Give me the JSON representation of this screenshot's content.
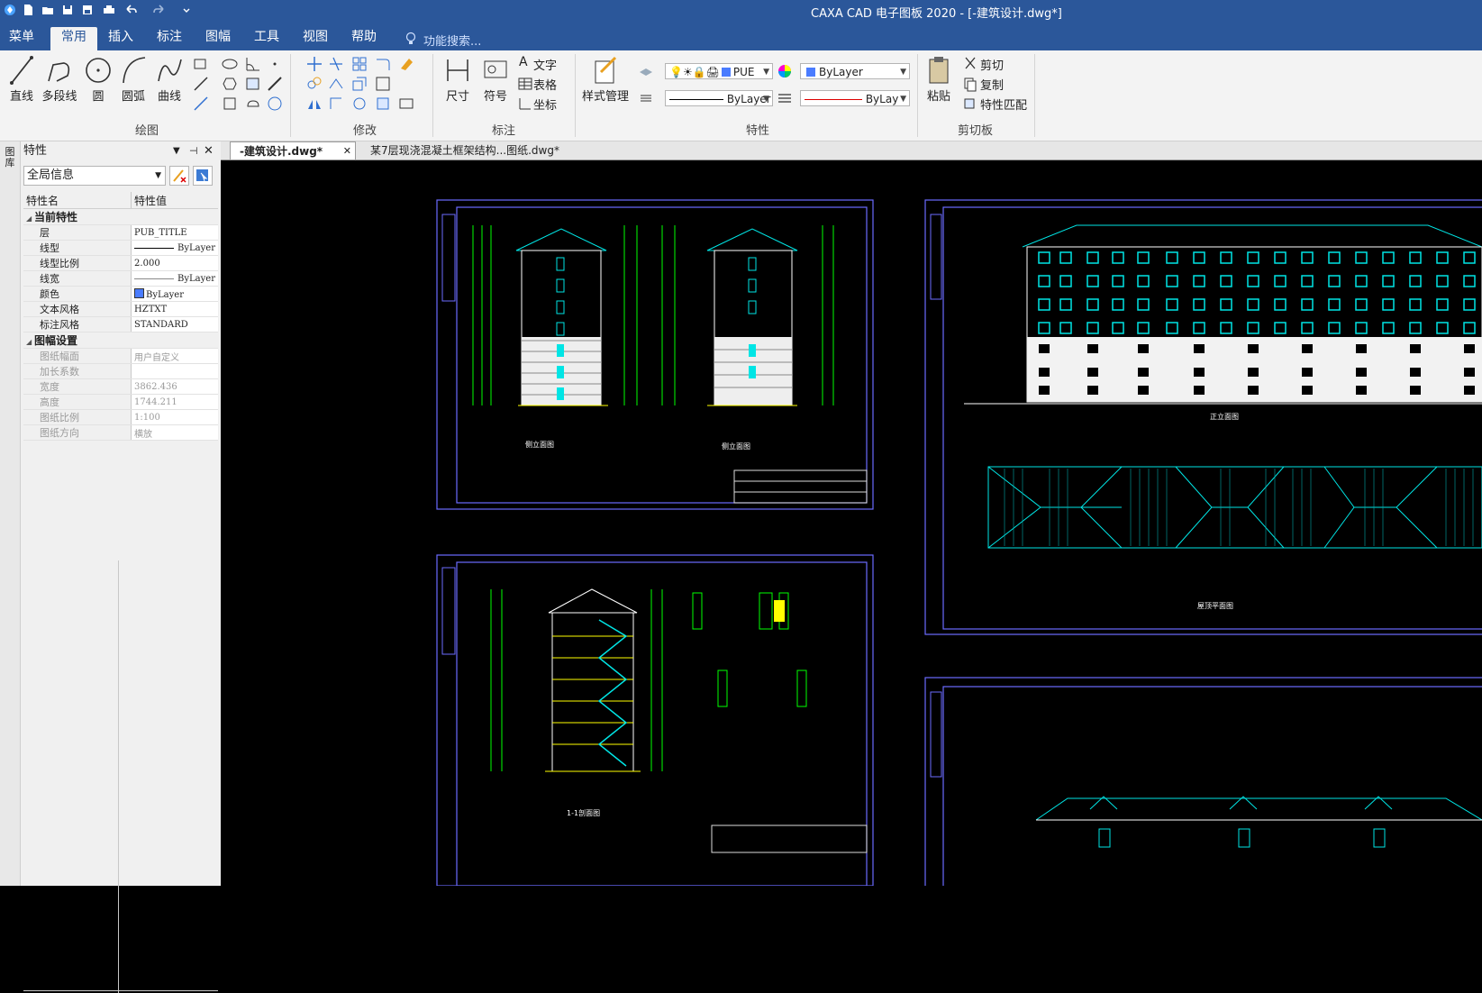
{
  "app": {
    "title": "CAXA CAD 电子图板 2020 - [-建筑设计.dwg*]"
  },
  "menu": {
    "tabs": [
      {
        "label": "菜单"
      },
      {
        "label": "常用"
      },
      {
        "label": "插入"
      },
      {
        "label": "标注"
      },
      {
        "label": "图幅"
      },
      {
        "label": "工具"
      },
      {
        "label": "视图"
      },
      {
        "label": "帮助"
      }
    ],
    "active_index": 1,
    "search_placeholder": "功能搜索..."
  },
  "ribbon": {
    "draw": {
      "label": "绘图",
      "tools": [
        "直线",
        "多段线",
        "圆",
        "圆弧",
        "曲线"
      ]
    },
    "modify": {
      "label": "修改"
    },
    "annotate": {
      "label": "标注",
      "tools": [
        "尺寸",
        "符号"
      ],
      "small": [
        "文字",
        "表格",
        "坐标"
      ]
    },
    "properties": {
      "label": "特性",
      "style_manager": "样式管理",
      "layer_value": "PUE",
      "color_value": "ByLayer",
      "linetype_value": "ByLayer",
      "lineweight_value": "ByLay"
    },
    "clipboard": {
      "label": "剪切板",
      "paste": "粘贴",
      "cut": "剪切",
      "copy": "复制",
      "match": "特性匹配"
    }
  },
  "panel": {
    "title": "特性",
    "side_tab": "图库",
    "scope": "全局信息",
    "columns": [
      "特性名",
      "特性值"
    ],
    "sections": [
      {
        "name": "当前特性",
        "rows": [
          {
            "k": "层",
            "v": "PUB_TITLE"
          },
          {
            "k": "线型",
            "v": "ByLayer"
          },
          {
            "k": "线型比例",
            "v": "2.000"
          },
          {
            "k": "线宽",
            "v": "ByLayer"
          },
          {
            "k": "颜色",
            "v": "ByLayer"
          },
          {
            "k": "文本风格",
            "v": "HZTXT"
          },
          {
            "k": "标注风格",
            "v": "STANDARD"
          }
        ]
      },
      {
        "name": "图幅设置",
        "rows": [
          {
            "k": "图纸幅面",
            "v": "用户自定义"
          },
          {
            "k": "加长系数",
            "v": ""
          },
          {
            "k": "宽度",
            "v": "3862.436"
          },
          {
            "k": "高度",
            "v": "1744.211"
          },
          {
            "k": "图纸比例",
            "v": "1:100"
          },
          {
            "k": "图纸方向",
            "v": "横放"
          }
        ]
      }
    ]
  },
  "documents": {
    "tabs": [
      {
        "label": "-建筑设计.dwg*"
      },
      {
        "label": "某7层现浇混凝土框架结构...图纸.dwg*"
      }
    ]
  },
  "drawing": {
    "sheet_labels": [
      "侧立面图",
      "侧立面图",
      "正立面图",
      "屋顶平面图",
      "1-1剖面图"
    ],
    "colors": {
      "background": "#000000",
      "frame": "#6b6bff",
      "cyan": "#00e5e5",
      "green": "#00ff00",
      "white": "#ffffff",
      "yellow": "#ffff00"
    }
  },
  "colors": {
    "titlebar": "#2b579a",
    "ribbon": "#f3f3f3",
    "panel": "#f0f0f0"
  }
}
